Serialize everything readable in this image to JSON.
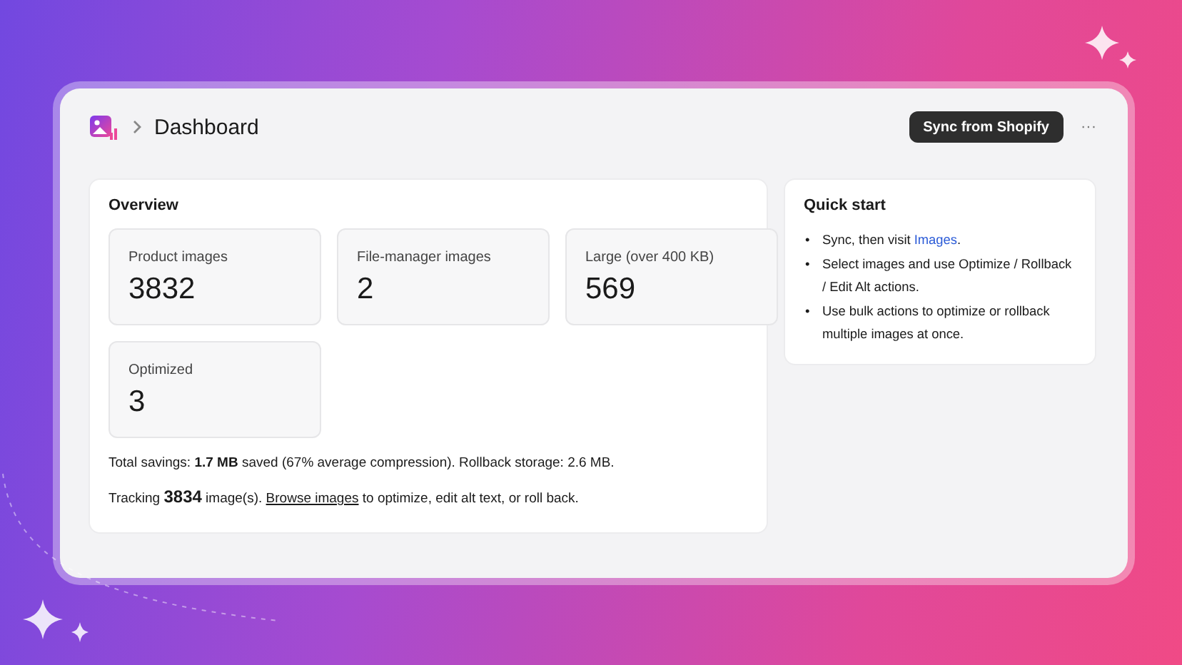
{
  "header": {
    "breadcrumb_title": "Dashboard",
    "sync_button": "Sync from Shopify",
    "more_button": "···"
  },
  "overview": {
    "title": "Overview",
    "stats": [
      {
        "label": "Product images",
        "value": "3832"
      },
      {
        "label": "File-manager images",
        "value": "2"
      },
      {
        "label": "Large (over 400 KB)",
        "value": "569"
      },
      {
        "label": "Optimized",
        "value": "3"
      }
    ],
    "savings": "Total savings: **1.7 MB** saved (67% average compression). Rollback storage: 2.6 MB.",
    "tracking": {
      "before": "Tracking **3834** image(s). ",
      "link": "Browse images",
      "after": " to optimize, edit alt text, or roll back."
    }
  },
  "quick_start": {
    "title": "Quick start",
    "items": [
      {
        "bullet": "•",
        "before": "Sync, then visit ",
        "link": "Images",
        "after": "."
      },
      {
        "bullet": "•",
        "before": "Select images and use Optimize / Rollback / Edit Alt actions."
      },
      {
        "bullet": "•",
        "before": "Use bulk actions to optimize or rollback multiple images at once."
      }
    ]
  }
}
